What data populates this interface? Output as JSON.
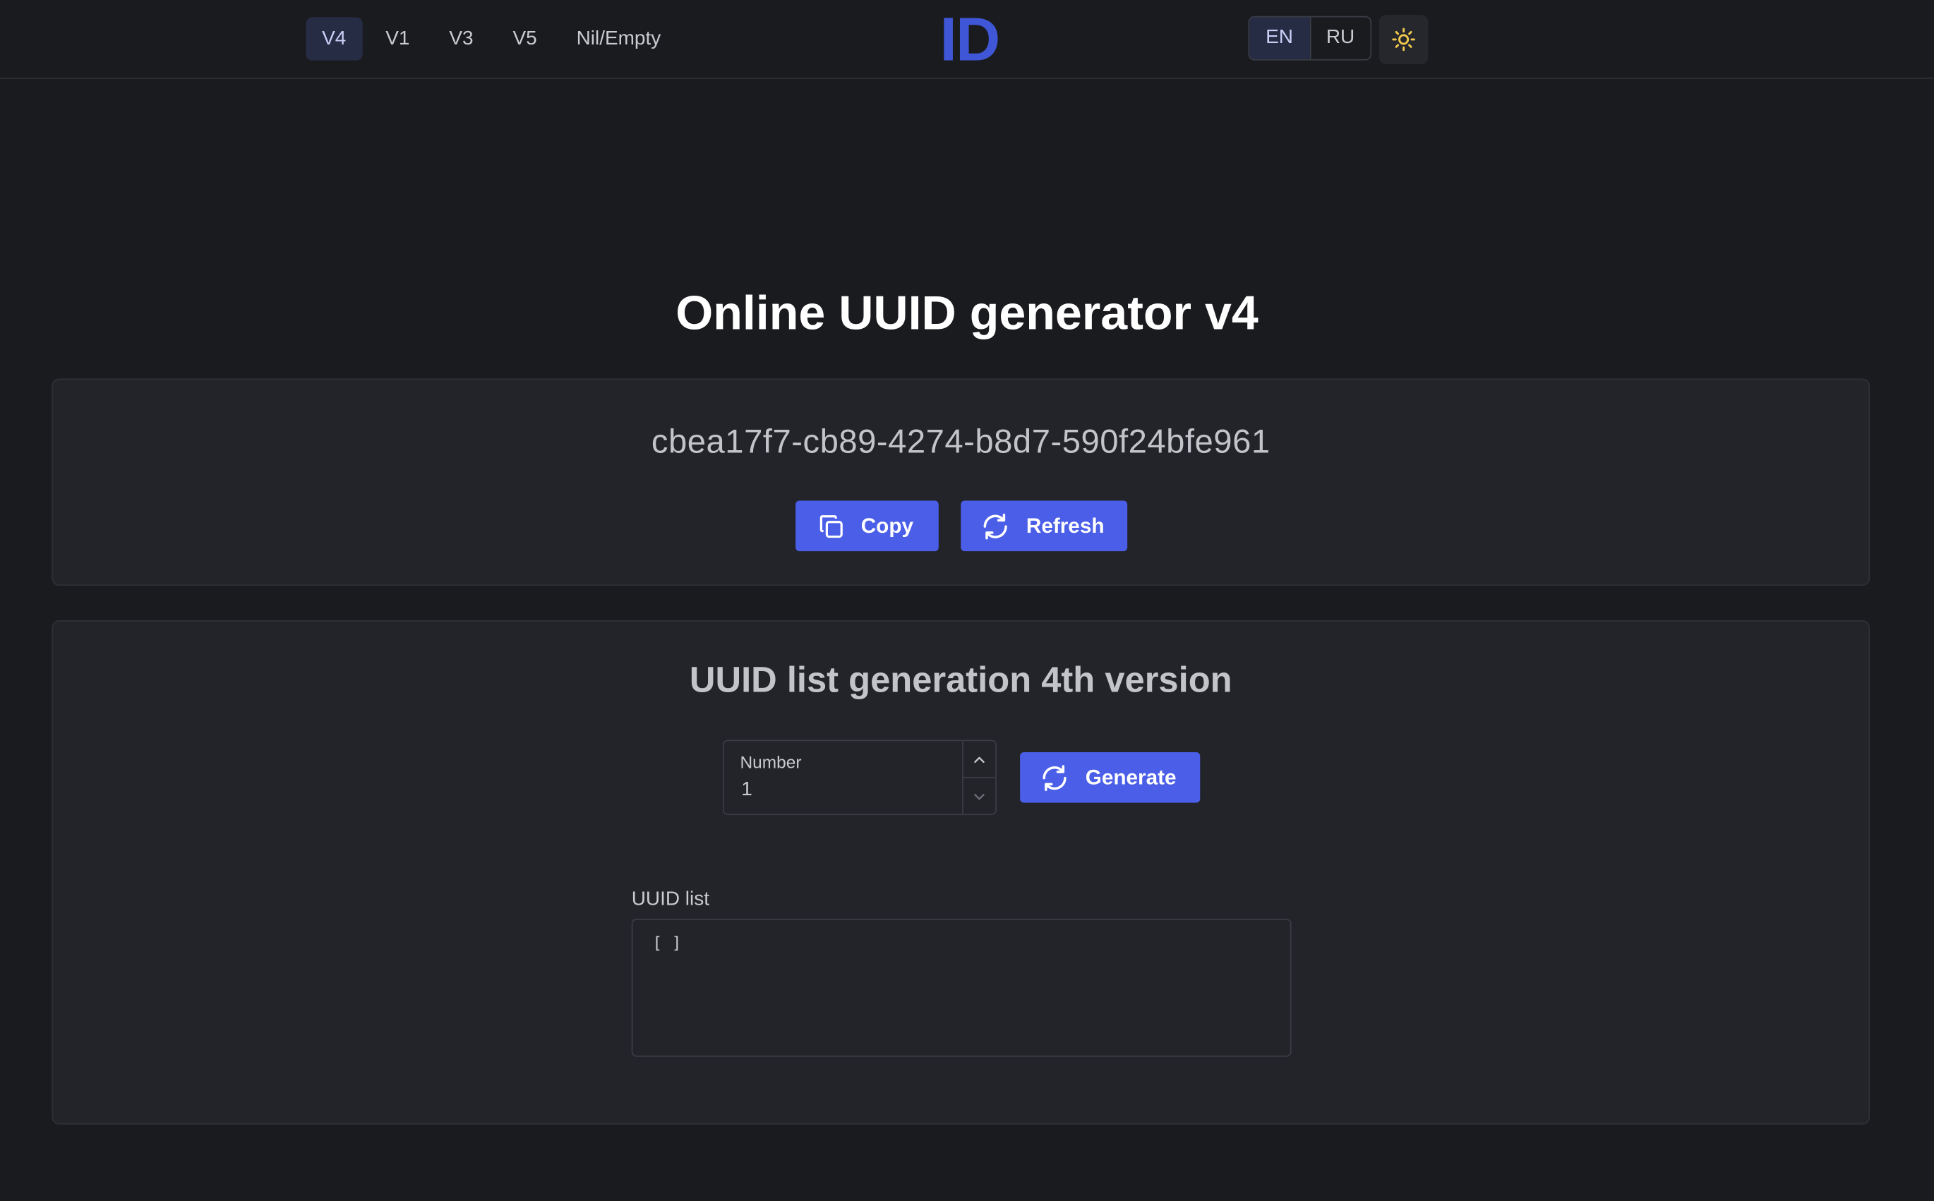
{
  "nav": {
    "tabs": [
      {
        "label": "V4",
        "active": true
      },
      {
        "label": "V1",
        "active": false
      },
      {
        "label": "V3",
        "active": false
      },
      {
        "label": "V5",
        "active": false
      },
      {
        "label": "Nil/Empty",
        "active": false
      }
    ],
    "logo_text": "ID",
    "languages": [
      {
        "label": "EN",
        "active": true
      },
      {
        "label": "RU",
        "active": false
      }
    ],
    "theme_icon": "sun-icon"
  },
  "main": {
    "title": "Online UUID generator v4",
    "uuid_card": {
      "uuid": "cbea17f7-cb89-4274-b8d7-590f24bfe961",
      "copy_label": "Copy",
      "refresh_label": "Refresh"
    },
    "list_card": {
      "title": "UUID list generation 4th version",
      "number_label": "Number",
      "number_value": "1",
      "generate_label": "Generate",
      "list_label": "UUID list",
      "list_value": "[ ]"
    }
  },
  "colors": {
    "background": "#1a1b1f",
    "card": "#232429",
    "accent": "#4a5ee8",
    "logo": "#3f57d6",
    "active_tab": "#272c45",
    "sun_icon": "#f2c94c"
  }
}
